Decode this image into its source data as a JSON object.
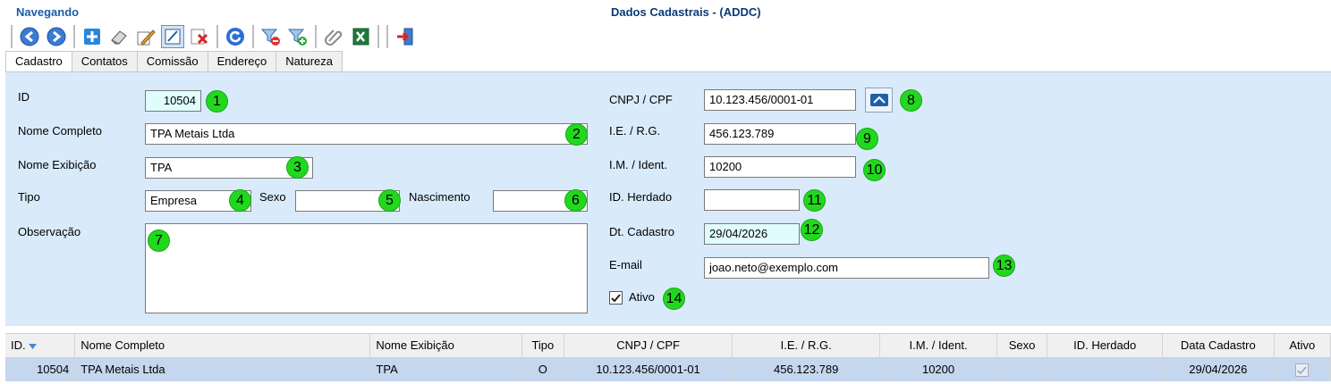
{
  "status_text": "Navegando",
  "window_title": "Dados Cadastrais - (ADDC)",
  "toolbar": {
    "icons": [
      "back-arrow-icon",
      "forward-arrow-icon",
      "add-icon",
      "eraser-icon",
      "edit-pencil-icon",
      "edit-form-icon",
      "delete-icon",
      "refresh-icon",
      "filter-remove-icon",
      "filter-add-icon",
      "attachment-icon",
      "excel-export-icon",
      "exit-icon"
    ]
  },
  "tabs": [
    "Cadastro",
    "Contatos",
    "Comissão",
    "Endereço",
    "Natureza"
  ],
  "form": {
    "id_label": "ID",
    "id_value": "10504",
    "nome_completo_label": "Nome Completo",
    "nome_completo_value": "TPA Metais Ltda",
    "nome_exibicao_label": "Nome Exibição",
    "nome_exibicao_value": "TPA",
    "tipo_label": "Tipo",
    "tipo_value": "Empresa",
    "sexo_label": "Sexo",
    "sexo_value": "",
    "nascimento_label": "Nascimento",
    "nascimento_value": "",
    "observacao_label": "Observação",
    "observacao_value": "",
    "cnpj_label": "CNPJ / CPF",
    "cnpj_value": "10.123.456/0001-01",
    "ie_label": "I.E. / R.G.",
    "ie_value": "456.123.789",
    "im_label": "I.M. / Ident.",
    "im_value": "10200",
    "id_herdado_label": "ID. Herdado",
    "id_herdado_value": "",
    "dt_cadastro_label": "Dt. Cadastro",
    "dt_cadastro_value": "29/04/2026",
    "email_label": "E-mail",
    "email_value": "joao.neto@exemplo.com",
    "ativo_label": "Ativo",
    "ativo_checked": true
  },
  "badges": [
    "1",
    "2",
    "3",
    "4",
    "5",
    "6",
    "7",
    "8",
    "9",
    "10",
    "11",
    "12",
    "13",
    "14"
  ],
  "grid": {
    "columns": [
      "ID.",
      "Nome Completo",
      "Nome Exibição",
      "Tipo",
      "CNPJ / CPF",
      "I.E. / R.G.",
      "I.M. / Ident.",
      "Sexo",
      "ID. Herdado",
      "Data Cadastro",
      "Ativo"
    ],
    "rows": [
      [
        "10504",
        "TPA Metais Ltda",
        "TPA",
        "O",
        "10.123.456/0001-01",
        "456.123.789",
        "10200",
        "",
        "",
        "29/04/2026",
        "checked"
      ]
    ]
  },
  "colors": {
    "panel_bg": "#d9eafb",
    "badge_green": "#22d81e",
    "selected_row": "#c5d7ee",
    "status_blue": "#1b5da8"
  }
}
